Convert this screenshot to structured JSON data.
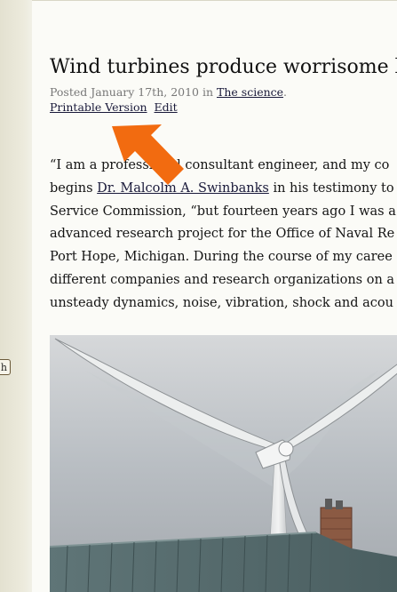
{
  "post": {
    "title": "Wind turbines produce worrisome low",
    "posted_prefix": "Posted ",
    "posted_date": "January 17th, 2010",
    "posted_in": " in ",
    "category": "The science",
    "category_suffix": "."
  },
  "actions": {
    "printable": "Printable Version",
    "edit": "Edit"
  },
  "body": {
    "l1": "“I am a professional consultant engineer, and my co",
    "l2_pre": "begins ",
    "l2_link": "Dr. Malcolm A. Swinbanks",
    "l2_post": " in his testimony to",
    "l3": "Service Commission, “but fourteen years ago I was a",
    "l4": "advanced research project for the Office of Naval Re",
    "l5": "Port Hope, Michigan.  During the course of my caree",
    "l6": "different companies and research organizations on a",
    "l7": "unsteady dynamics, noise, vibration, shock and acou"
  },
  "sidebar": {
    "search_button": "h"
  },
  "colors": {
    "arrow": "#f26b10",
    "content_bg": "#fbfbf7",
    "gutter_bg": "#ecebdf"
  },
  "image": {
    "subject": "wind-turbine-photo"
  }
}
